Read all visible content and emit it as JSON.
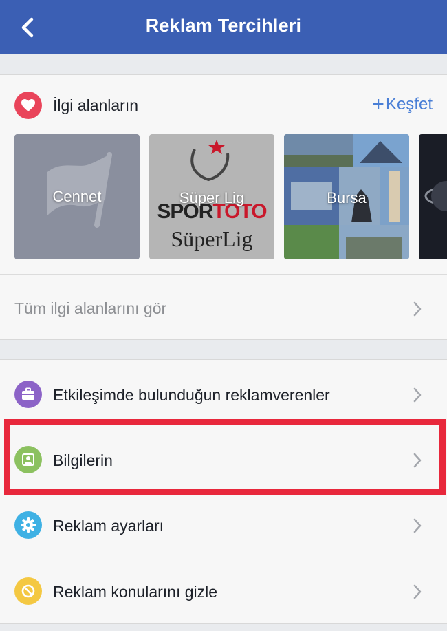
{
  "nav": {
    "title": "Reklam Tercihleri"
  },
  "interests": {
    "title": "İlgi alanların",
    "explore_label": "Keşfet",
    "tiles": [
      {
        "label": "Cennet"
      },
      {
        "label": "Süper Lig",
        "logo_top": "SPOR",
        "logo_accent": "TOTO",
        "logo_bottom": "SüperLig"
      },
      {
        "label": "Bursa"
      },
      {
        "label": ""
      }
    ],
    "see_all_label": "Tüm ilgi alanlarını gör"
  },
  "menu": {
    "items": [
      {
        "label": "Etkileşimde bulunduğun reklamverenler",
        "icon": "briefcase-icon",
        "color": "#8c63c7"
      },
      {
        "label": "Bilgilerin",
        "icon": "contact-card-icon",
        "color": "#8cc160"
      },
      {
        "label": "Reklam ayarları",
        "icon": "gear-icon",
        "color": "#3fb1e4"
      },
      {
        "label": "Reklam konularını gizle",
        "icon": "hide-icon",
        "color": "#f4c842"
      }
    ]
  },
  "colors": {
    "navbar": "#3b5fb4",
    "highlight": "#e8283c",
    "link": "#4a7fd6"
  }
}
